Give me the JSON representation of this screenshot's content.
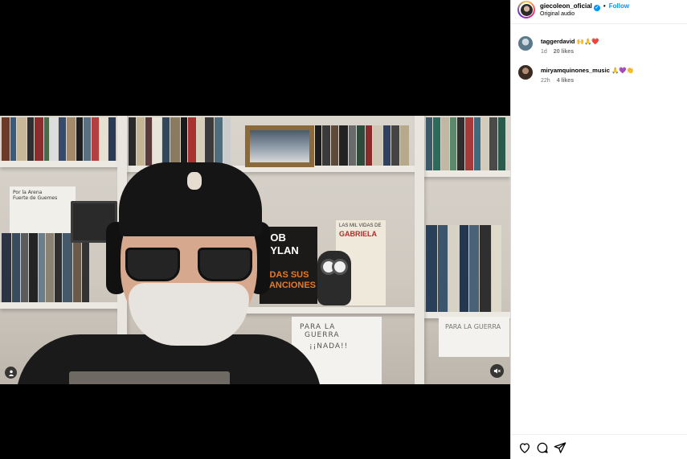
{
  "post": {
    "username": "giecoleon_oficial",
    "verified_icon": "verified-badge-icon",
    "separator": "•",
    "follow_label": "Follow",
    "audio_label": "Original audio"
  },
  "video": {
    "user_tag_icon": "person-icon",
    "mute_icon": "speaker-muted-icon",
    "scene_text": {
      "poster_bob_line1": "BOB",
      "poster_bob_line2": "DYLAN",
      "poster_bob_line3": "ODAS SUS",
      "poster_bob_line4": "CANCIONES",
      "poster_gab_top": "LAS MIL VIDAS DE",
      "poster_gab_name": "GABRIELA",
      "board_line1": "PARA LA",
      "board_line2": "GUERRA",
      "board_line3": "¡¡NADA!!",
      "board2_text": "PARA LA GUERRA",
      "note_line1": "Por la Arena",
      "note_line2": "Fuerte de Guemes"
    }
  },
  "comments": [
    {
      "username": "taggerdavid",
      "text": "🙌🙏❤️",
      "time": "1d",
      "likes": "20 likes",
      "avatar_color": "#5a7a8c"
    },
    {
      "username": "miryamquinones_music",
      "text": "🙏💜👏",
      "time": "22h",
      "likes": "4 likes",
      "avatar_color": "#3a2a22"
    }
  ],
  "actions": {
    "like_icon": "heart-icon",
    "comment_icon": "comment-bubble-icon",
    "share_icon": "paper-plane-icon"
  },
  "colors": {
    "accent": "#0095f6",
    "secondary_text": "#737373",
    "panel_bg": "#ffffff",
    "media_bg": "#000000"
  }
}
